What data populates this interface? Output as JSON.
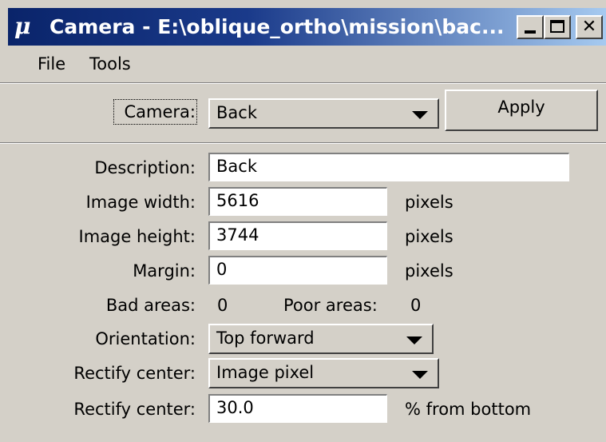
{
  "window": {
    "title": "Camera - E:\\oblique_ortho\\mission\\bac...",
    "icon": "mu-icon"
  },
  "menu": {
    "file": "File",
    "tools": "Tools"
  },
  "camera": {
    "label": "Camera:",
    "selected": "Back",
    "apply_label": "Apply"
  },
  "form": {
    "description_label": "Description:",
    "description_value": "Back",
    "image_width_label": "Image width:",
    "image_width_value": "5616",
    "image_height_label": "Image height:",
    "image_height_value": "3744",
    "margin_label": "Margin:",
    "margin_value": "0",
    "pixels_unit": "pixels",
    "bad_areas_label": "Bad areas:",
    "bad_areas_value": "0",
    "poor_areas_label": "Poor areas:",
    "poor_areas_value": "0",
    "orientation_label": "Orientation:",
    "orientation_value": "Top forward",
    "rectify_center_label_1": "Rectify center:",
    "rectify_center_value_1": "Image pixel",
    "rectify_center_label_2": "Rectify center:",
    "rectify_center_value_2": "30.0",
    "rectify_center_unit": "% from bottom"
  }
}
